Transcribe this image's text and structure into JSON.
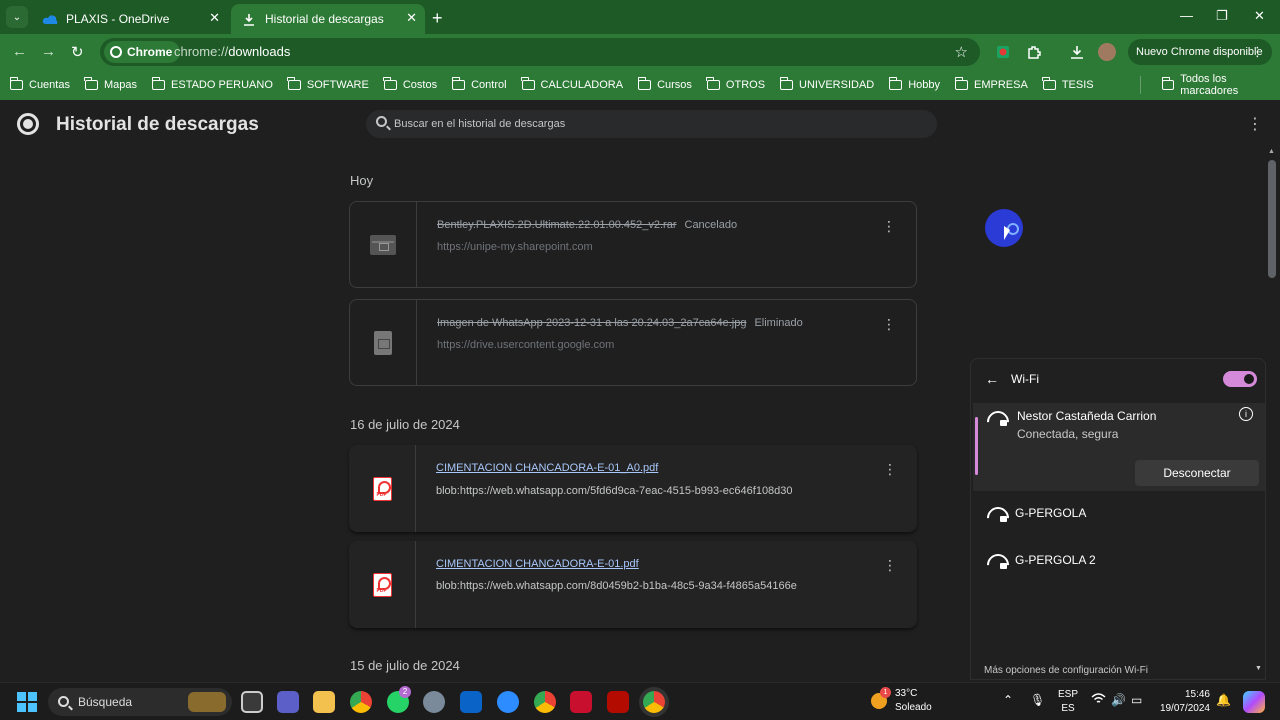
{
  "browser": {
    "tabs": [
      {
        "label": "PLAXIS - OneDrive",
        "icon": "onedrive-icon"
      },
      {
        "label": "Historial de descargas",
        "icon": "download-icon"
      }
    ],
    "chip_label": "Chrome",
    "url_prefix": "chrome://",
    "url_path": "downloads",
    "update_button": "Nuevo Chrome disponible",
    "bookmarks": [
      "Cuentas",
      "Mapas",
      "ESTADO PERUANO",
      "SOFTWARE",
      "Costos",
      "Control",
      "CALCULADORA",
      "Cursos",
      "OTROS",
      "UNIVERSIDAD",
      "Hobby",
      "EMPRESA",
      "TESIS"
    ],
    "all_bookmarks": "Todos los marcadores",
    "colors": {
      "theme_dark": "#1d5a26",
      "theme": "#2d7a36"
    }
  },
  "page": {
    "title": "Historial de descargas",
    "search_placeholder": "Buscar en el historial de descargas",
    "sections": [
      {
        "label": "Hoy",
        "items": [
          {
            "name": "Bentley.PLAXIS.2D.Ultimate.22.01.00.452_v2.rar",
            "status": "Cancelado",
            "url": "https://unipe-my.sharepoint.com",
            "icon": "archive-file-icon"
          },
          {
            "name": "Imagen de WhatsApp 2023-12-31 a las 20.24.03_2a7ca64e.jpg",
            "status": "Eliminado",
            "url": "https://drive.usercontent.google.com",
            "icon": "image-file-icon"
          }
        ]
      },
      {
        "label": "16 de julio de 2024",
        "items": [
          {
            "name": "CIMENTACION CHANCADORA-E-01_A0.pdf",
            "url": "blob:https://web.whatsapp.com/5fd6d9ca-7eac-4515-b993-ec646f108d30",
            "icon": "pdf-file-icon"
          },
          {
            "name": "CIMENTACION CHANCADORA-E-01.pdf",
            "url": "blob:https://web.whatsapp.com/8d0459b2-b1ba-48c5-9a34-f4865a54166e",
            "icon": "pdf-file-icon"
          }
        ]
      },
      {
        "label": "15 de julio de 2024",
        "items": []
      }
    ]
  },
  "wifi": {
    "title": "Wi-Fi",
    "enabled": true,
    "networks": [
      {
        "name": "Nestor Castañeda Carrion",
        "status": "Conectada, segura",
        "action": "Desconectar"
      },
      {
        "name": "G-PERGOLA"
      },
      {
        "name": "G-PERGOLA 2"
      }
    ],
    "more": "Más opciones de configuración Wi-Fi",
    "accent": "#d58ad9"
  },
  "taskbar": {
    "search_label": "Búsqueda",
    "whatsapp_badge": "2",
    "weather_badge": "1",
    "temperature": "33°C",
    "condition": "Soleado",
    "lang_top": "ESP",
    "lang_bottom": "ES",
    "time": "15:46",
    "date": "19/07/2024"
  }
}
